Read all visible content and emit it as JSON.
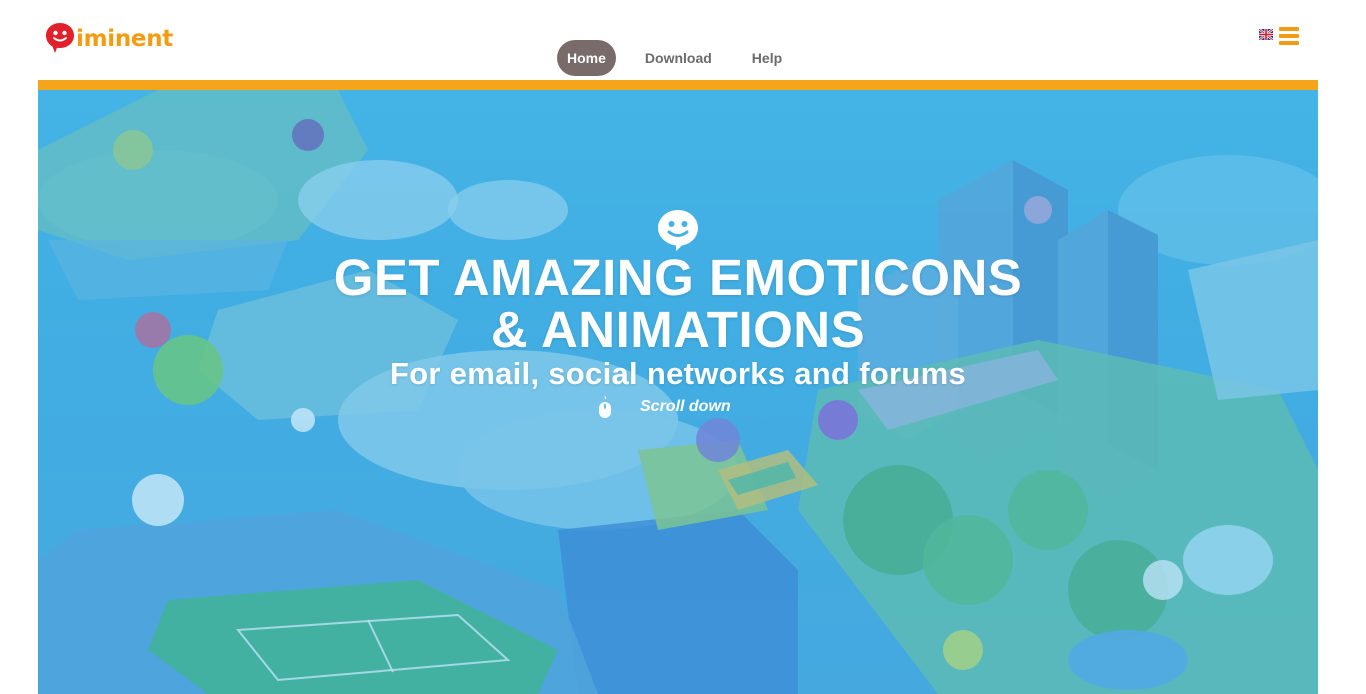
{
  "brand": {
    "name": "iminent",
    "colors": {
      "accent": "#f39c12",
      "bar": "#f5a51b",
      "hero_blue": "#45b0e3",
      "nav_active": "#7a6b6b",
      "logo_bubble": "#e0202a"
    }
  },
  "nav": {
    "items": [
      {
        "label": "Home",
        "active": true
      },
      {
        "label": "Download",
        "active": false
      },
      {
        "label": "Help",
        "active": false
      }
    ]
  },
  "header_tools": {
    "language_icon": "uk-flag-icon",
    "menu_icon": "hamburger-menu-icon"
  },
  "hero": {
    "icon": "speech-bubble-smiley-icon",
    "headline_line1": "GET AMAZING EMOTICONS",
    "headline_line2": "& ANIMATIONS",
    "subheadline": "For email, social networks and forums",
    "scroll_label": "Scroll down",
    "scroll_icon": "mouse-icon"
  }
}
